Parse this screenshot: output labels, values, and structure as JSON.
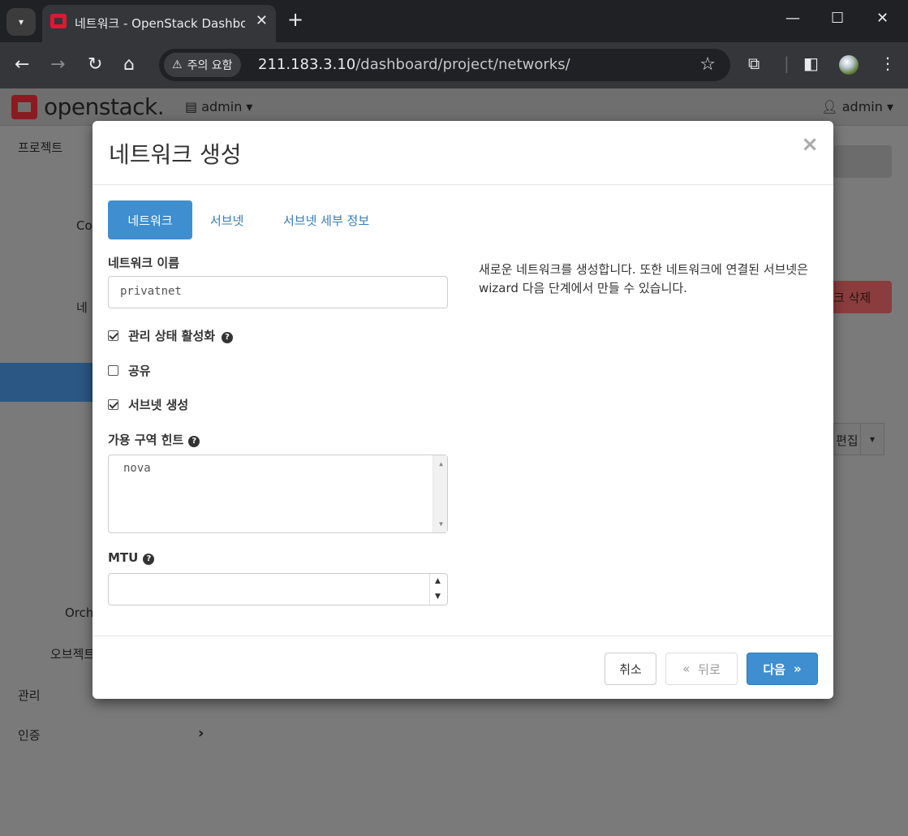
{
  "browser": {
    "tab_title": "네트워크 - OpenStack Dashboard",
    "new_tab": "+",
    "security_label": "주의 요함",
    "url_host": "211.183.3.10",
    "url_path": "/dashboard/project/networks/"
  },
  "app": {
    "logo_text": "openstack.",
    "project_selector": "admin",
    "user_menu": "admin",
    "sidebar": {
      "project": "프로젝트",
      "compute_partial": "Co",
      "network_partial": "네",
      "orchestration_partial": "Orch",
      "object_store_partial": "오브젝트",
      "admin": "관리",
      "identity": "인증"
    },
    "bg_delete_partial": "크 삭제",
    "bg_edit_partial": "편집"
  },
  "modal": {
    "title": "네트워크 생성",
    "close": "×",
    "tabs": [
      {
        "label": "네트워크",
        "active": true
      },
      {
        "label": "서브넷",
        "active": false
      },
      {
        "label": "서브넷 세부 정보",
        "active": false
      }
    ],
    "network_name_label": "네트워크 이름",
    "network_name_value": "privatnet",
    "admin_state_label": "관리 상태 활성화",
    "admin_state_checked": true,
    "shared_label": "공유",
    "shared_checked": false,
    "create_subnet_label": "서브넷 생성",
    "create_subnet_checked": true,
    "az_hint_label": "가용 구역 힌트",
    "az_hint_value": "nova",
    "mtu_label": "MTU",
    "mtu_value": "",
    "description": "새로운 네트워크를 생성합니다. 또한 네트워크에 연결된 서브넷은 wizard 다음 단계에서 만들 수 있습니다.",
    "buttons": {
      "cancel": "취소",
      "back": "뒤로",
      "next": "다음"
    }
  },
  "colors": {
    "primary": "#3e8ed0",
    "link": "#337ab7",
    "tab_bar": "#202124",
    "toolbar": "#35363a"
  }
}
